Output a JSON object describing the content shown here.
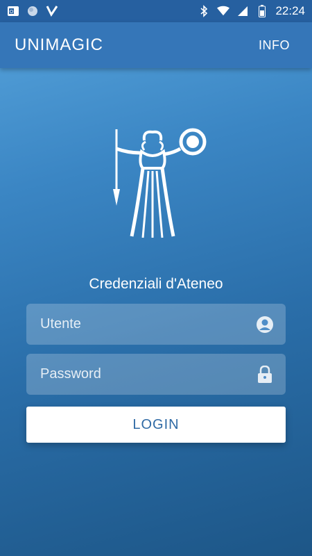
{
  "status_bar": {
    "time": "22:24",
    "left_icons": [
      "outlook-icon",
      "blob-icon",
      "check-app-icon"
    ],
    "right_icons": [
      "bluetooth-icon",
      "wifi-icon",
      "signal-icon",
      "battery-icon"
    ]
  },
  "app_bar": {
    "title": "UNIMAGIC",
    "info_label": "INFO"
  },
  "login": {
    "section_title": "Credenziali d'Ateneo",
    "username_placeholder": "Utente",
    "password_placeholder": "Password",
    "button_label": "LOGIN"
  },
  "colors": {
    "status_bar": "#2660a0",
    "app_bar": "#3576b8",
    "button_text": "#2f6aa5"
  }
}
